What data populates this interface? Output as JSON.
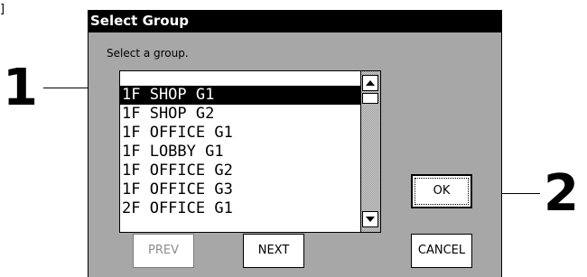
{
  "corner_mark": "]",
  "callouts": [
    {
      "number": "1"
    },
    {
      "number": "2"
    }
  ],
  "dialog": {
    "title": "Select Group",
    "prompt": "Select a group.",
    "list": {
      "items": [
        "1F SHOP G1",
        "1F SHOP G2",
        "1F OFFICE G1",
        "1F LOBBY G1",
        "1F OFFICE G2",
        "1F OFFICE G3",
        "2F OFFICE G1"
      ],
      "selected_index": 0
    },
    "buttons": {
      "prev": "PREV",
      "next": "NEXT",
      "ok": "OK",
      "cancel": "CANCEL"
    },
    "icons": {
      "scroll_up": "triangle-up-icon",
      "scroll_down": "triangle-down-icon"
    }
  }
}
